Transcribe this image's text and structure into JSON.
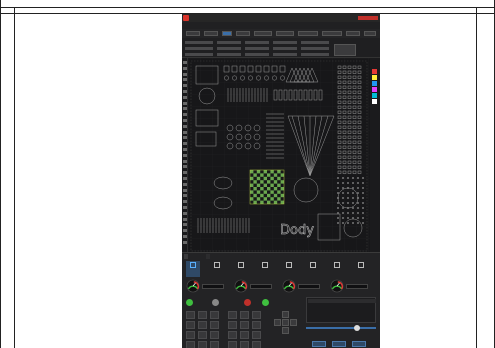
{
  "app": {
    "title": "",
    "menu": [],
    "panel_tabs": [],
    "toolbar_icons": [
      {
        "icon": "display-icon"
      },
      {
        "icon": "preview-icon"
      },
      {
        "icon": "frame-icon"
      },
      {
        "icon": "start-icon"
      },
      {
        "icon": "pause-icon"
      },
      {
        "icon": "stop-icon"
      },
      {
        "icon": "output-icon"
      },
      {
        "icon": "expand-icon"
      }
    ],
    "gauges": [
      {
        "icon": "speed-gauge-icon",
        "color": "#3fbf3f"
      },
      {
        "icon": "power-gauge-icon",
        "color": "#3fbf3f"
      },
      {
        "icon": "min-power-gauge-icon",
        "color": "#3fbf3f"
      },
      {
        "icon": "air-gauge-icon",
        "color": "#3fbf3f"
      }
    ],
    "palette": [
      "#e53935",
      "#ffeb3b",
      "#2196f3",
      "#e040fb",
      "#00bcd4",
      "#ffffff"
    ],
    "accent": "#d9342b",
    "canvas_text": "Dody"
  }
}
